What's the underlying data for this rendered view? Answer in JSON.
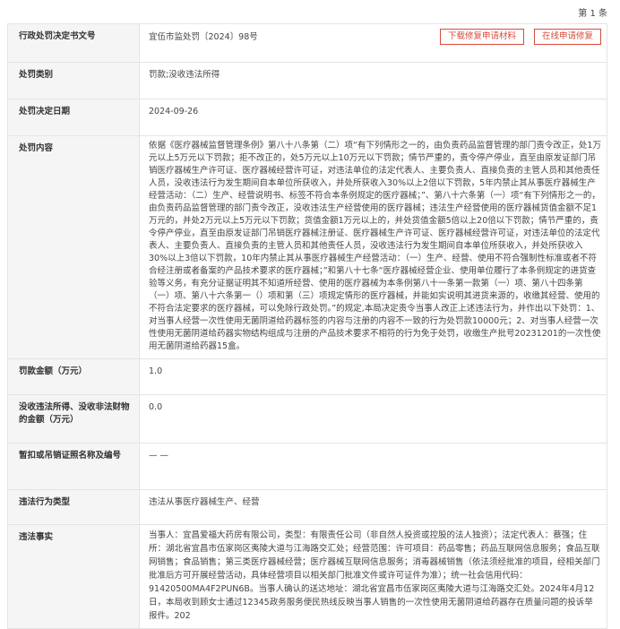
{
  "page": {
    "page_number": "第 1 条"
  },
  "buttons": {
    "download": "下载修复申请材料",
    "online": "在线申请修复"
  },
  "rows": {
    "doc_no": {
      "label": "行政处罚决定书文号",
      "value": "宜伍市监处罚〔2024〕98号"
    },
    "category": {
      "label": "处罚类别",
      "value": "罚款;没收违法所得"
    },
    "date": {
      "label": "处罚决定日期",
      "value": "2024-09-26"
    },
    "content": {
      "label": "处罚内容",
      "value": "依据《医疗器械监督管理条例》第八十八条第（二）项“有下列情形之一的，由负责药品监督管理的部门责令改正，处1万元以上5万元以下罚款；拒不改正的，处5万元以上10万元以下罚款；情节严重的，责令停产停业，直至由原发证部门吊销医疗器械生产许可证、医疗器械经营许可证，对违法单位的法定代表人、主要负责人、直接负责的主管人员和其他责任人员，没收违法行为发生期间自本单位所获收入，并处所获收入30%以上2倍以下罚款，5年内禁止其从事医疗器械生产经营活动：（二）生产、经营说明书、标签不符合本条例规定的医疗器械；”、第八十六条第（一）项“有下列情形之一的，由负责药品监督管理的部门责令改正，没收违法生产经营使用的医疗器械；违法生产经营使用的医疗器械货值金额不足1万元的，并处2万元以上5万元以下罚款；货值金额1万元以上的，并处货值金额5倍以上20倍以下罚款；情节严重的，责令停产停业，直至由原发证部门吊销医疗器械注册证、医疗器械生产许可证、医疗器械经营许可证，对违法单位的法定代表人、主要负责人、直接负责的主管人员和其他责任人员，没收违法行为发生期间自本单位所获收入，并处所获收入30%以上3倍以下罚款，10年内禁止其从事医疗器械生产经营活动：（一）生产、经营、使用不符合强制性标准或者不符合经注册或者备案的产品技术要求的医疗器械；”和第八十七条“医疗器械经营企业、使用单位履行了本条例规定的进货查验等义务，有充分证据证明其不知道所经营、使用的医疗器械为本条例第八十一条第一款第（一）项、第八十四条第（一）项、第八十六条第一（）项和第（三）项规定情形的医疗器械，并能如实说明其进货来源的，收缴其经营、使用的不符合法定要求的医疗器械，可以免除行政处罚。”的规定,本局决定责令当事人改正上述违法行为，并作出以下处罚：1、对当事人经营一次性使用无菌阴道给药器标签的内容与注册的内容不一致的行为处罚款10000元；2、对当事人经营一次性使用无菌阴道给药器实物结构组成与注册的产品技术要求不相符的行为免于处罚，收缴生产批号20231201的一次性使用无菌阴道给药器15盒。"
    },
    "fine": {
      "label": "罚款金额（万元）",
      "value": "1.0"
    },
    "confiscation": {
      "label": "没收违法所得、没收非法财物的金额（万元）",
      "value": "0.0"
    },
    "permit": {
      "label": "暂扣或吊销证照名称及编号",
      "value": "— —"
    },
    "violation_type": {
      "label": "违法行为类型",
      "value": "违法从事医疗器械生产、经营"
    },
    "facts": {
      "label": "违法事实",
      "value": "当事人：宜昌爱福大药房有限公司，类型：有限责任公司（非自然人投资或控股的法人独资）；法定代表人：蔡强；住所：湖北省宜昌市伍家岗区夷陵大道与江海路交汇处；经营范围：许可项目：药品零售；药品互联网信息服务；食品互联网销售；食品销售；第三类医疗器械经营；医疗器械互联网信息服务；消毒器械销售（依法须经批准的项目，经相关部门批准后方可开展经营活动，具体经营项目以相关部门批准文件或许可证件为准）；统一社会信用代码：91420500MA4F2PUN6B。当事人确认的送达地址：湖北省宜昌市伍家岗区夷陵大道与江海路交汇处。2024年4月12日，本局收到顾女士通过12345政务服务便民热线反映当事人销售的一次性使用无菌阴道给药器存在质量问题的投诉举报件。202"
    }
  }
}
